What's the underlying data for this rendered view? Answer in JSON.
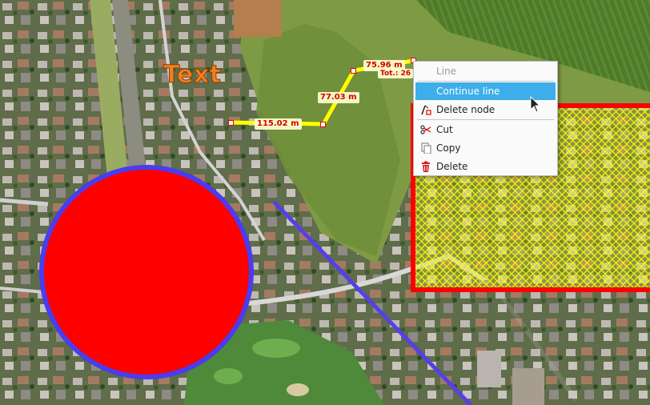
{
  "map": {
    "text_label": "Text",
    "segments": [
      {
        "length": "115.02 m"
      },
      {
        "length": "77.03 m"
      },
      {
        "length": "75.96 m"
      }
    ],
    "total_label": "Tot.: 26",
    "colors": {
      "measure_line": "#ffff00",
      "circle_fill": "#ff0000",
      "circle_stroke": "#4a3cf0",
      "polygon_border": "#ff0000",
      "polygon_hatch": "#ffff00",
      "blue_line": "#5540e8",
      "label_text": "#d40000",
      "text_label": "#f07f1f"
    }
  },
  "context_menu": {
    "title": "Line",
    "items": [
      {
        "label": "Continue line",
        "icon": "continue-line-icon",
        "active": true
      },
      {
        "label": "Delete node",
        "icon": "delete-node-icon",
        "active": false
      },
      {
        "label": "Cut",
        "icon": "scissors-icon",
        "active": false
      },
      {
        "label": "Copy",
        "icon": "copy-icon",
        "active": false
      },
      {
        "label": "Delete",
        "icon": "trash-icon",
        "active": false
      }
    ]
  }
}
